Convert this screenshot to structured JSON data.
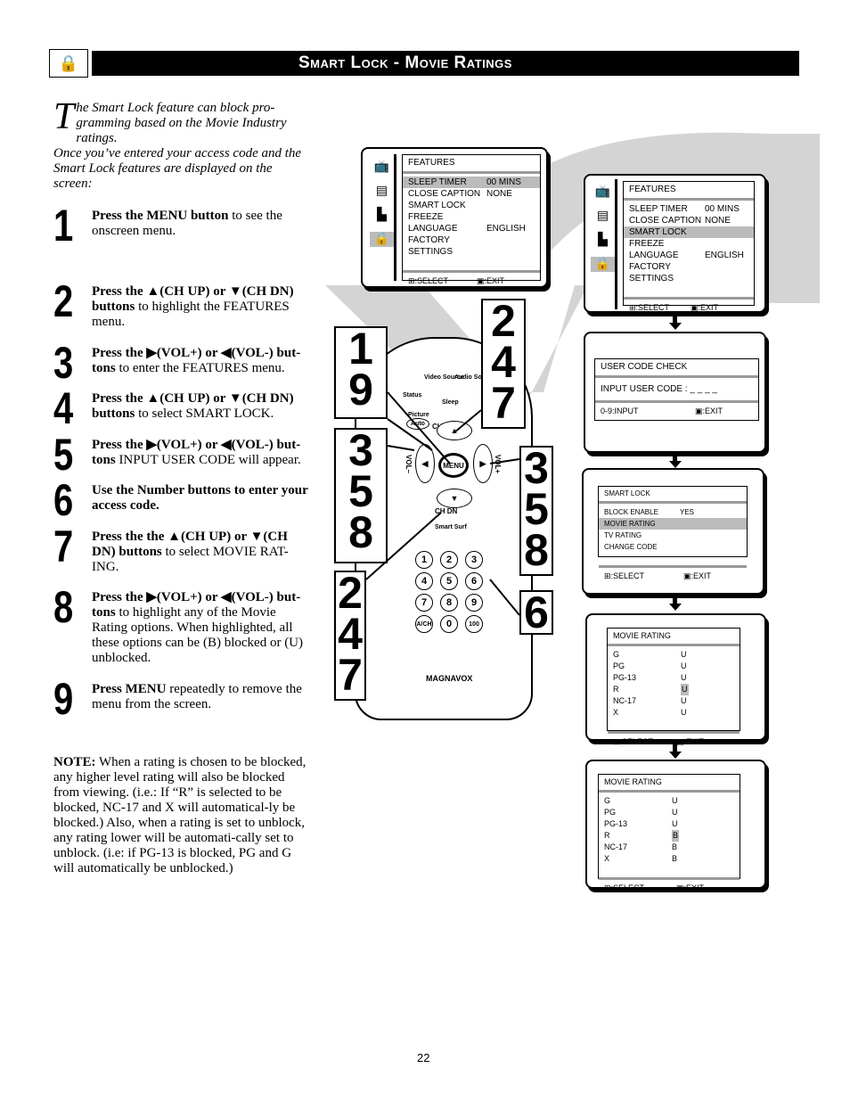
{
  "header": {
    "title": "Smart Lock - Movie Ratings",
    "icon": "smart-lock-icon"
  },
  "intro": {
    "dropcap": "T",
    "text1": "he Smart Lock feature can block pro-gramming based on the Movie Industry ratings.",
    "text2": "Once you’ve entered your access code and the Smart Lock features are displayed on the screen:"
  },
  "steps": [
    {
      "num": "1",
      "bold": "Press the MENU button",
      "rest": " to see the onscreen menu."
    },
    {
      "num": "2",
      "bold": "Press the ▲(CH UP) or ▼(CH DN) buttons",
      "rest": " to highlight the FEATURES menu."
    },
    {
      "num": "3",
      "bold": "Press the ▶(VOL+) or ◀(VOL-) but-tons",
      "rest": " to enter the FEATURES menu."
    },
    {
      "num": "4",
      "bold": "Press the ▲(CH UP) or ▼(CH DN) buttons",
      "rest": " to select SMART LOCK."
    },
    {
      "num": "5",
      "bold": "Press the ▶(VOL+) or ◀(VOL-) but-tons",
      "rest": " INPUT USER CODE will appear."
    },
    {
      "num": "6",
      "bold": "Use the Number buttons to enter your access code.",
      "rest": ""
    },
    {
      "num": "7",
      "bold": "Press the the ▲(CH UP) or ▼(CH DN) buttons",
      "rest": " to select MOVIE RAT-ING."
    },
    {
      "num": "8",
      "bold": "Press the ▶(VOL+) or ◀(VOL-) but-tons",
      "rest": " to highlight any of the Movie Rating options.  When highlighted, all these options can be (B) blocked or (U) unblocked."
    },
    {
      "num": "9",
      "bold": "Press MENU",
      "rest": " repeatedly to remove the menu from the screen."
    }
  ],
  "note": {
    "label": "NOTE:",
    "text": " When a  rating is chosen to be blocked, any higher level rating will also be blocked from viewing. (i.e.: If “R” is selected to be blocked, NC-17 and X will automatical-ly be blocked.) Also, when a rating is set to unblock, any rating lower will be automati-cally set to unblock. (i.e: if PG-13 is blocked, PG and G will automatically be unblocked.)"
  },
  "callouts": {
    "a": [
      "1",
      "9"
    ],
    "b": [
      "2",
      "4",
      "7"
    ],
    "c": [
      "3",
      "5",
      "8"
    ],
    "d": [
      "3",
      "5",
      "8"
    ],
    "e": [
      "6"
    ],
    "f": [
      "2",
      "4",
      "7"
    ]
  },
  "remote": {
    "brand": "MAGNAVOX",
    "video_source": "Video Source",
    "audio_source": "Audio Source",
    "status": "Status",
    "sleep": "Sleep",
    "picture": "Picture",
    "auto": "Auto",
    "ch_up": "CH   UP",
    "ch_dn": "CH   DN",
    "vol_minus": "VOL–",
    "vol_plus": "VOL+",
    "menu": "MENU",
    "smart_surf": "Smart Surf",
    "keys": [
      "1",
      "2",
      "3",
      "4",
      "5",
      "6",
      "7",
      "8",
      "9",
      "A/CH",
      "0",
      "100"
    ]
  },
  "features_menu": {
    "title": "FEATURES",
    "items": [
      [
        "SLEEP TIMER",
        "00 MINS"
      ],
      [
        "CLOSE CAPTION",
        "NONE"
      ],
      [
        "SMART LOCK",
        ""
      ],
      [
        "FREEZE",
        ""
      ],
      [
        "LANGUAGE",
        "ENGLISH"
      ],
      [
        "FACTORY SETTINGS",
        ""
      ]
    ],
    "select": ":SELECT",
    "exit": ":EXIT"
  },
  "user_code": {
    "title": "USER CODE CHECK",
    "prompt": "INPUT USER CODE : _ _ _ _",
    "input": "0-9:INPUT",
    "exit": ":EXIT"
  },
  "smart_lock_menu": {
    "title": "SMART LOCK",
    "items": [
      [
        "BLOCK ENABLE",
        "YES"
      ],
      [
        "MOVIE RATING",
        ""
      ],
      [
        "TV RATING",
        ""
      ],
      [
        "CHANGE CODE",
        ""
      ]
    ],
    "select": ":SELECT",
    "exit": ":EXIT"
  },
  "movie_rating_1": {
    "title": "MOVIE RATING",
    "items": [
      [
        "G",
        "U"
      ],
      [
        "PG",
        "U"
      ],
      [
        "PG-13",
        "U"
      ],
      [
        "R",
        "U"
      ],
      [
        "NC-17",
        "U"
      ],
      [
        "X",
        "U"
      ]
    ],
    "select": ":SELECT",
    "exit": ":EXIT"
  },
  "movie_rating_2": {
    "title": "MOVIE RATING",
    "items": [
      [
        "G",
        "U"
      ],
      [
        "PG",
        "U"
      ],
      [
        "PG-13",
        "U"
      ],
      [
        "R",
        "B"
      ],
      [
        "NC-17",
        "B"
      ],
      [
        "X",
        "B"
      ]
    ],
    "select": ":SELECT",
    "exit": ":EXIT"
  },
  "page_number": "22"
}
